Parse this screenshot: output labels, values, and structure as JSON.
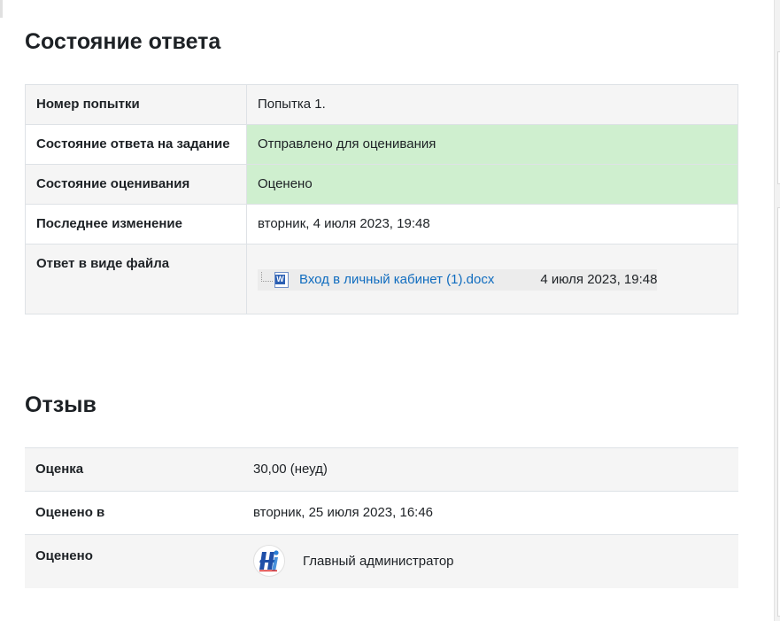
{
  "status_section": {
    "title": "Состояние ответа",
    "rows": [
      {
        "label": "Номер попытки",
        "value": "Попытка 1."
      },
      {
        "label": "Состояние ответа на задание",
        "value": "Отправлено для оценивания"
      },
      {
        "label": "Состояние оценивания",
        "value": "Оценено"
      },
      {
        "label": "Последнее изменение",
        "value": "вторник, 4 июля 2023, 19:48"
      },
      {
        "label": "Ответ в виде файла",
        "file_name": "Вход в личный кабинет (1).docx",
        "file_date": "4 июля 2023, 19:48"
      }
    ]
  },
  "feedback_section": {
    "title": "Отзыв",
    "rows": [
      {
        "label": "Оценка",
        "value": "30,00 (неуд)"
      },
      {
        "label": "Оценено в",
        "value": "вторник, 25 июля 2023, 16:46"
      },
      {
        "label": "Оценено",
        "value": "Главный администратор"
      }
    ]
  },
  "icons": {
    "file_icon": "word-document-icon",
    "grader_avatar": "user-avatar-icon"
  },
  "colors": {
    "success_bg": "#cfefcf",
    "link": "#0f6cbf"
  }
}
